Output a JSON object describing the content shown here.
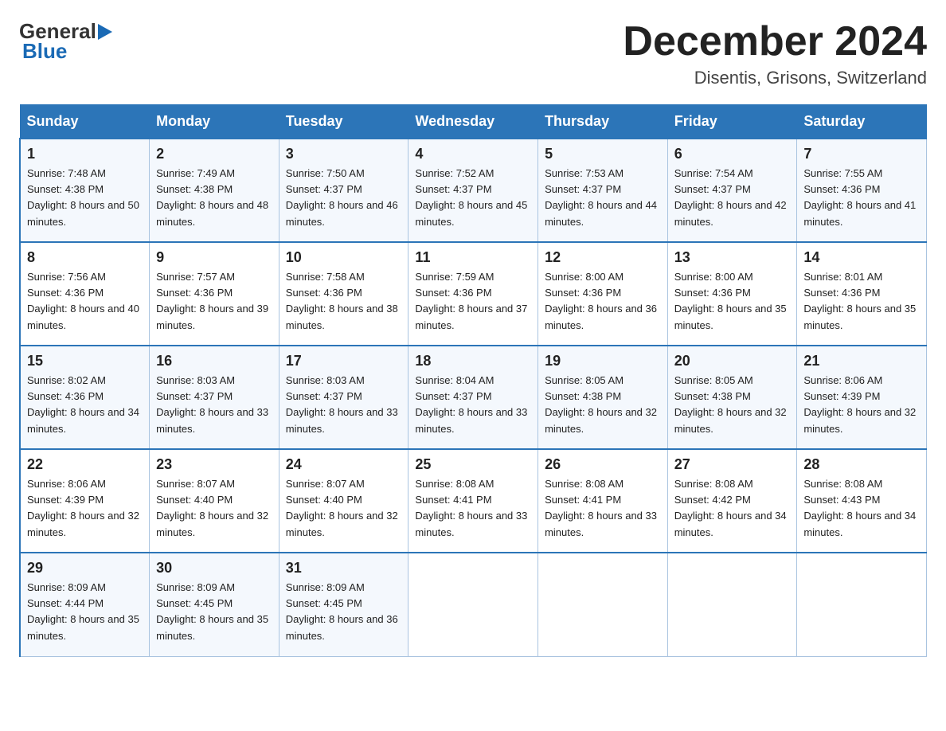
{
  "header": {
    "logo": {
      "general": "General",
      "blue": "Blue",
      "tagline": "Blue"
    },
    "title": "December 2024",
    "subtitle": "Disentis, Grisons, Switzerland"
  },
  "days_of_week": [
    "Sunday",
    "Monday",
    "Tuesday",
    "Wednesday",
    "Thursday",
    "Friday",
    "Saturday"
  ],
  "weeks": [
    [
      {
        "day": "1",
        "sunrise": "7:48 AM",
        "sunset": "4:38 PM",
        "daylight": "8 hours and 50 minutes."
      },
      {
        "day": "2",
        "sunrise": "7:49 AM",
        "sunset": "4:38 PM",
        "daylight": "8 hours and 48 minutes."
      },
      {
        "day": "3",
        "sunrise": "7:50 AM",
        "sunset": "4:37 PM",
        "daylight": "8 hours and 46 minutes."
      },
      {
        "day": "4",
        "sunrise": "7:52 AM",
        "sunset": "4:37 PM",
        "daylight": "8 hours and 45 minutes."
      },
      {
        "day": "5",
        "sunrise": "7:53 AM",
        "sunset": "4:37 PM",
        "daylight": "8 hours and 44 minutes."
      },
      {
        "day": "6",
        "sunrise": "7:54 AM",
        "sunset": "4:37 PM",
        "daylight": "8 hours and 42 minutes."
      },
      {
        "day": "7",
        "sunrise": "7:55 AM",
        "sunset": "4:36 PM",
        "daylight": "8 hours and 41 minutes."
      }
    ],
    [
      {
        "day": "8",
        "sunrise": "7:56 AM",
        "sunset": "4:36 PM",
        "daylight": "8 hours and 40 minutes."
      },
      {
        "day": "9",
        "sunrise": "7:57 AM",
        "sunset": "4:36 PM",
        "daylight": "8 hours and 39 minutes."
      },
      {
        "day": "10",
        "sunrise": "7:58 AM",
        "sunset": "4:36 PM",
        "daylight": "8 hours and 38 minutes."
      },
      {
        "day": "11",
        "sunrise": "7:59 AM",
        "sunset": "4:36 PM",
        "daylight": "8 hours and 37 minutes."
      },
      {
        "day": "12",
        "sunrise": "8:00 AM",
        "sunset": "4:36 PM",
        "daylight": "8 hours and 36 minutes."
      },
      {
        "day": "13",
        "sunrise": "8:00 AM",
        "sunset": "4:36 PM",
        "daylight": "8 hours and 35 minutes."
      },
      {
        "day": "14",
        "sunrise": "8:01 AM",
        "sunset": "4:36 PM",
        "daylight": "8 hours and 35 minutes."
      }
    ],
    [
      {
        "day": "15",
        "sunrise": "8:02 AM",
        "sunset": "4:36 PM",
        "daylight": "8 hours and 34 minutes."
      },
      {
        "day": "16",
        "sunrise": "8:03 AM",
        "sunset": "4:37 PM",
        "daylight": "8 hours and 33 minutes."
      },
      {
        "day": "17",
        "sunrise": "8:03 AM",
        "sunset": "4:37 PM",
        "daylight": "8 hours and 33 minutes."
      },
      {
        "day": "18",
        "sunrise": "8:04 AM",
        "sunset": "4:37 PM",
        "daylight": "8 hours and 33 minutes."
      },
      {
        "day": "19",
        "sunrise": "8:05 AM",
        "sunset": "4:38 PM",
        "daylight": "8 hours and 32 minutes."
      },
      {
        "day": "20",
        "sunrise": "8:05 AM",
        "sunset": "4:38 PM",
        "daylight": "8 hours and 32 minutes."
      },
      {
        "day": "21",
        "sunrise": "8:06 AM",
        "sunset": "4:39 PM",
        "daylight": "8 hours and 32 minutes."
      }
    ],
    [
      {
        "day": "22",
        "sunrise": "8:06 AM",
        "sunset": "4:39 PM",
        "daylight": "8 hours and 32 minutes."
      },
      {
        "day": "23",
        "sunrise": "8:07 AM",
        "sunset": "4:40 PM",
        "daylight": "8 hours and 32 minutes."
      },
      {
        "day": "24",
        "sunrise": "8:07 AM",
        "sunset": "4:40 PM",
        "daylight": "8 hours and 32 minutes."
      },
      {
        "day": "25",
        "sunrise": "8:08 AM",
        "sunset": "4:41 PM",
        "daylight": "8 hours and 33 minutes."
      },
      {
        "day": "26",
        "sunrise": "8:08 AM",
        "sunset": "4:41 PM",
        "daylight": "8 hours and 33 minutes."
      },
      {
        "day": "27",
        "sunrise": "8:08 AM",
        "sunset": "4:42 PM",
        "daylight": "8 hours and 34 minutes."
      },
      {
        "day": "28",
        "sunrise": "8:08 AM",
        "sunset": "4:43 PM",
        "daylight": "8 hours and 34 minutes."
      }
    ],
    [
      {
        "day": "29",
        "sunrise": "8:09 AM",
        "sunset": "4:44 PM",
        "daylight": "8 hours and 35 minutes."
      },
      {
        "day": "30",
        "sunrise": "8:09 AM",
        "sunset": "4:45 PM",
        "daylight": "8 hours and 35 minutes."
      },
      {
        "day": "31",
        "sunrise": "8:09 AM",
        "sunset": "4:45 PM",
        "daylight": "8 hours and 36 minutes."
      },
      null,
      null,
      null,
      null
    ]
  ]
}
